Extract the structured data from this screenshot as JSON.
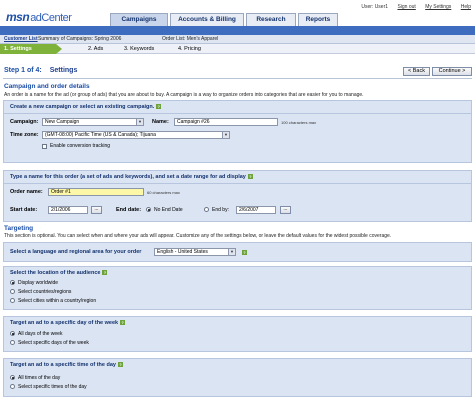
{
  "header": {
    "logo_brand": "msn",
    "logo_product": "adCenter",
    "user": "User: User1",
    "links": [
      "Sign out",
      "My Settings",
      "Help"
    ],
    "tabs": [
      "Campaigns",
      "Accounts & Billing",
      "Research",
      "Reports"
    ],
    "active_tab": "Campaigns"
  },
  "breadcrumb": {
    "customer": "Customer List",
    "summary": "Summary of Campaigns: Spring 2006",
    "order": "Order List: Men's Apparel"
  },
  "steps": [
    "1. Settings",
    "2. Ads",
    "3. Keywords",
    "4. Pricing"
  ],
  "step_header": {
    "label": "Step 1 of 4:",
    "title": "Settings",
    "back": "< Back",
    "continue": "Continue >"
  },
  "campaign_section": {
    "title": "Campaign and order details",
    "desc": "An order is a name for the ad (or group of ads) that you are about to buy. A campaign is a way to organize orders into categories that are easier for you to manage."
  },
  "campaign_panel": {
    "title": "Create a new campaign or select an existing campaign.",
    "campaign_label": "Campaign:",
    "campaign_value": "New Campaign",
    "name_label": "Name:",
    "name_value": "Campaign #26",
    "name_hint": "100 characters max",
    "timezone_label": "Time zone:",
    "timezone_value": "(GMT-08:00) Pacific Time (US & Canada); Tijuana",
    "conversion_label": "Enable conversion tracking"
  },
  "order_panel": {
    "title": "Type a name for this order (a set of ads and keywords), and set a date range for ad display",
    "order_label": "Order name:",
    "order_value": "Order #1",
    "order_hint": "60 characters max",
    "start_label": "Start date:",
    "start_value": "2/1/2006",
    "end_label": "End date:",
    "no_end": "No End Date",
    "end_by": "End by:",
    "end_value": "2/6/2007",
    "cal_btn": "..."
  },
  "targeting": {
    "title": "Targeting",
    "desc": "This section is optional. You can select when and where your ads will appear. Customize any of the settings below, or leave the default values for the widest possible coverage."
  },
  "language_panel": {
    "title": "Select a language and regional area for your order",
    "value": "English - United States"
  },
  "location_panel": {
    "title": "Select the location of the audience",
    "options": [
      "Display worldwide",
      "Select countries/regions",
      "Select cities within a country/region"
    ],
    "selected": 0
  },
  "day_panel": {
    "title": "Target an ad to a specific day of the week",
    "options": [
      "All days of the week",
      "Select specific days of the week"
    ],
    "selected": 0
  },
  "time_panel": {
    "title": "Target an ad to a specific time of the day",
    "options": [
      "All times of the day",
      "Select specific times of the day"
    ],
    "selected": 0
  },
  "help_glyph": "?"
}
